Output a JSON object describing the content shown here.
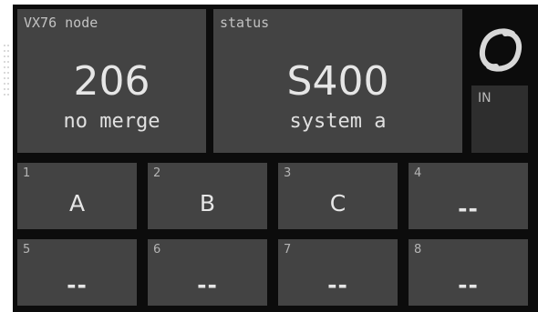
{
  "node_panel": {
    "title": "VX76 node",
    "value": "206",
    "sub": "no merge"
  },
  "status_panel": {
    "title": "status",
    "value": "S400",
    "sub": "system a"
  },
  "indicator": {
    "label": "IN"
  },
  "slots": [
    {
      "num": "1",
      "value": "A"
    },
    {
      "num": "2",
      "value": "B"
    },
    {
      "num": "3",
      "value": "C"
    },
    {
      "num": "4",
      "value": "--"
    },
    {
      "num": "5",
      "value": "--"
    },
    {
      "num": "6",
      "value": "--"
    },
    {
      "num": "7",
      "value": "--"
    },
    {
      "num": "8",
      "value": "--"
    }
  ],
  "icons": {
    "logo": "brand-logo-icon"
  },
  "colors": {
    "background": "#0c0c0c",
    "panel": "#434343",
    "indicator": "#2e2e2e",
    "text": "#e6e6e6"
  }
}
